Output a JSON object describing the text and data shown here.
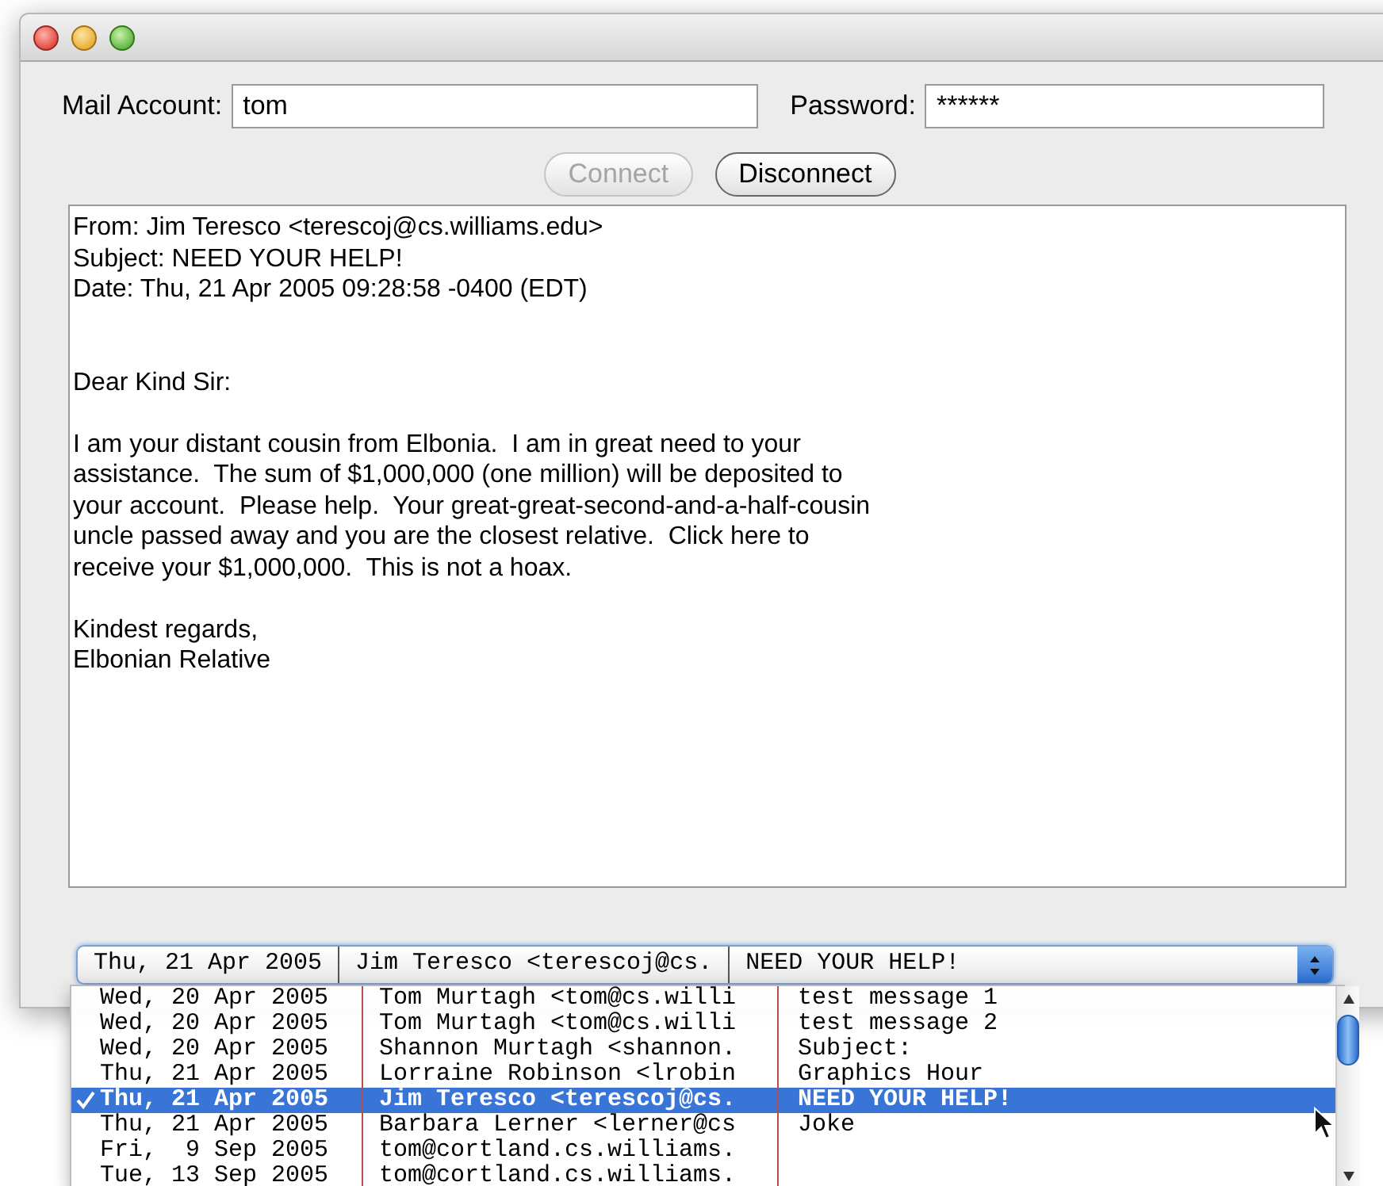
{
  "account": {
    "label": "Mail Account:",
    "value": "tom"
  },
  "password": {
    "label": "Password:",
    "value": "******"
  },
  "buttons": [
    {
      "label": "Connect",
      "disabled": true
    },
    {
      "label": "Disconnect",
      "disabled": false
    }
  ],
  "message": {
    "header": [
      "From: Jim Teresco <terescoj@cs.williams.edu>",
      "Subject: NEED YOUR HELP!",
      "Date: Thu, 21 Apr 2005 09:28:58 -0400 (EDT)"
    ],
    "paragraphs": [
      [
        "Dear Kind Sir:"
      ],
      [
        "I am your distant cousin from Elbonia.  I am in great need to your",
        "assistance.  The sum of $1,000,000 (one million) will be deposited to",
        "your account.  Please help.  Your great-great-second-and-a-half-cousin",
        "uncle passed away and you are the closest relative.  Click here to",
        "receive your $1,000,000.  This is not a hoax."
      ],
      [
        "Kindest regards,",
        "Elbonian Relative"
      ]
    ]
  },
  "message_popup": {
    "value": [
      "Thu, 21 Apr 2005",
      "Jim Teresco <terescoj@cs.",
      "NEED YOUR HELP!"
    ],
    "items": [
      {
        "cells": [
          "Wed, 20 Apr 2005",
          "Tom Murtagh <tom@cs.willi",
          "test message 1"
        ],
        "selected": false
      },
      {
        "cells": [
          "Wed, 20 Apr 2005",
          "Tom Murtagh <tom@cs.willi",
          "test message 2"
        ],
        "selected": false
      },
      {
        "cells": [
          "Wed, 20 Apr 2005",
          "Shannon Murtagh <shannon.",
          "Subject:"
        ],
        "selected": false
      },
      {
        "cells": [
          "Thu, 21 Apr 2005",
          "Lorraine Robinson <lrobin",
          "Graphics Hour"
        ],
        "selected": false
      },
      {
        "cells": [
          "Thu, 21 Apr 2005",
          "Jim Teresco <terescoj@cs.",
          "NEED YOUR HELP!"
        ],
        "selected": true
      },
      {
        "cells": [
          "Thu, 21 Apr 2005",
          "Barbara Lerner <lerner@cs",
          "Joke"
        ],
        "selected": false
      },
      {
        "cells": [
          "Fri,  9 Sep 2005",
          "tom@cortland.cs.williams."
        ],
        "selected": false
      },
      {
        "cells": [
          "Tue, 13 Sep 2005",
          "tom@cortland.cs.williams."
        ],
        "selected": false
      }
    ]
  }
}
